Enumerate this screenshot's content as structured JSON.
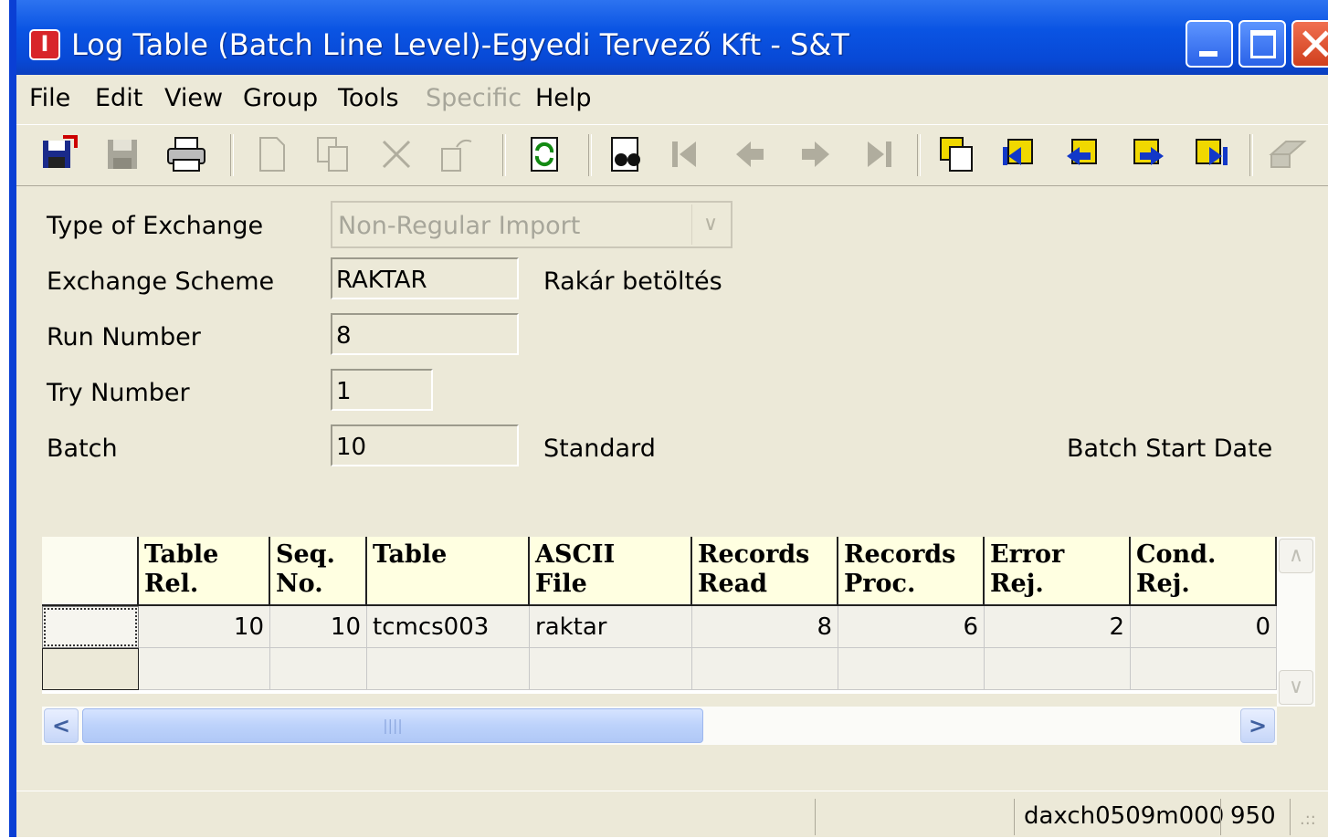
{
  "window": {
    "title": "Log Table (Batch Line Level)-Egyedi Tervező  Kft - S&T",
    "app_icon": "Ⓘ"
  },
  "menu": [
    "File",
    "Edit",
    "View",
    "Group",
    "Tools",
    "Specific",
    "Help"
  ],
  "menu_disabled": [
    "Specific"
  ],
  "toolbar_icons": [
    "save-and-exit-icon",
    "save-icon",
    "print-icon",
    "new-icon",
    "copy-icon",
    "delete-icon",
    "change-icon",
    "refresh-icon",
    "find-icon",
    "first-record-icon",
    "previous-record-icon",
    "next-record-icon",
    "last-record-icon",
    "new-group-icon",
    "first-group-icon",
    "previous-group-icon",
    "next-group-icon",
    "last-group-icon",
    "text-icon"
  ],
  "form": {
    "type_of_exchange": {
      "label": "Type of Exchange",
      "value": "Non-Regular Import"
    },
    "exchange_scheme": {
      "label": "Exchange Scheme",
      "value": "RAKTAR",
      "description": "Rakár betöltés"
    },
    "run_number": {
      "label": "Run Number",
      "value": "8"
    },
    "try_number": {
      "label": "Try Number",
      "value": "1"
    },
    "batch": {
      "label": "Batch",
      "value": "10",
      "description": "Standard",
      "start_date_label": "Batch Start Date"
    }
  },
  "grid": {
    "columns": [
      {
        "line1": "Table",
        "line2": "Rel."
      },
      {
        "line1": "Seq.",
        "line2": "No."
      },
      {
        "line1": "Table",
        "line2": ""
      },
      {
        "line1": "ASCII",
        "line2": "File"
      },
      {
        "line1": "Records",
        "line2": "Read"
      },
      {
        "line1": "Records",
        "line2": "Proc."
      },
      {
        "line1": "Error",
        "line2": "Rej."
      },
      {
        "line1": "Cond.",
        "line2": "Rej."
      }
    ],
    "rows": [
      [
        "10",
        "10",
        "tcmcs003",
        "raktar",
        "8",
        "6",
        "2",
        "0"
      ],
      [
        "",
        "",
        "",
        "",
        "",
        "",
        "",
        ""
      ]
    ]
  },
  "status": {
    "panel1": "",
    "panel2": "",
    "session": "daxch0509m000",
    "company": "950"
  }
}
